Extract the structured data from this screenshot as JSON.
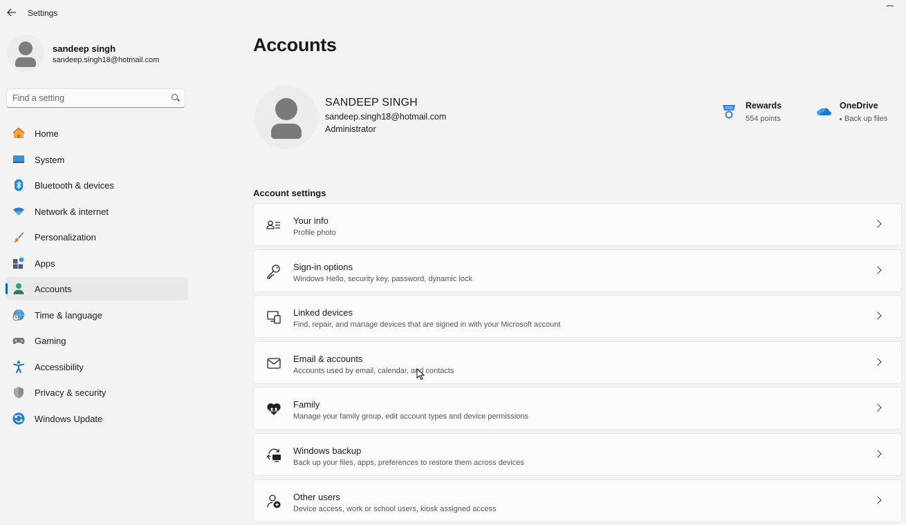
{
  "window": {
    "title": "Settings"
  },
  "profile": {
    "name": "sandeep singh",
    "email": "sandeep.singh18@hotmail.com"
  },
  "search": {
    "placeholder": "Find a setting"
  },
  "nav": {
    "items": [
      {
        "label": "Home",
        "icon": "home-icon"
      },
      {
        "label": "System",
        "icon": "system-icon"
      },
      {
        "label": "Bluetooth & devices",
        "icon": "bluetooth-icon"
      },
      {
        "label": "Network & internet",
        "icon": "wifi-icon"
      },
      {
        "label": "Personalization",
        "icon": "brush-icon"
      },
      {
        "label": "Apps",
        "icon": "apps-icon"
      },
      {
        "label": "Accounts",
        "icon": "accounts-icon",
        "active": true
      },
      {
        "label": "Time & language",
        "icon": "globe-clock-icon"
      },
      {
        "label": "Gaming",
        "icon": "gamepad-icon"
      },
      {
        "label": "Accessibility",
        "icon": "accessibility-icon"
      },
      {
        "label": "Privacy & security",
        "icon": "shield-icon"
      },
      {
        "label": "Windows Update",
        "icon": "update-icon"
      }
    ]
  },
  "page": {
    "title": "Accounts"
  },
  "user": {
    "name": "SANDEEP SINGH",
    "email": "sandeep.singh18@hotmail.com",
    "role": "Administrator"
  },
  "rewards": {
    "title": "Rewards",
    "points": "554 points"
  },
  "onedrive": {
    "title": "OneDrive",
    "status": "Back up files"
  },
  "account_settings": {
    "heading": "Account settings",
    "items": [
      {
        "title": "Your info",
        "subtitle": "Profile photo",
        "icon": "person-list-icon"
      },
      {
        "title": "Sign-in options",
        "subtitle": "Windows Hello, security key, password, dynamic lock",
        "icon": "key-icon"
      },
      {
        "title": "Linked devices",
        "subtitle": "Find, repair, and manage devices that are signed in with your Microsoft account",
        "icon": "linked-devices-icon"
      },
      {
        "title": "Email & accounts",
        "subtitle": "Accounts used by email, calendar, and contacts",
        "icon": "mail-icon"
      },
      {
        "title": "Family",
        "subtitle": "Manage your family group, edit account types and device permissions",
        "icon": "family-heart-icon"
      },
      {
        "title": "Windows backup",
        "subtitle": "Back up your files, apps, preferences to restore them across devices",
        "icon": "backup-icon"
      },
      {
        "title": "Other users",
        "subtitle": "Device access, work or school users, kiosk assigned access",
        "icon": "add-user-icon"
      }
    ]
  },
  "colors": {
    "accent": "#0067c0",
    "background": "#f3f3f3",
    "card": "#fbfbfb"
  }
}
